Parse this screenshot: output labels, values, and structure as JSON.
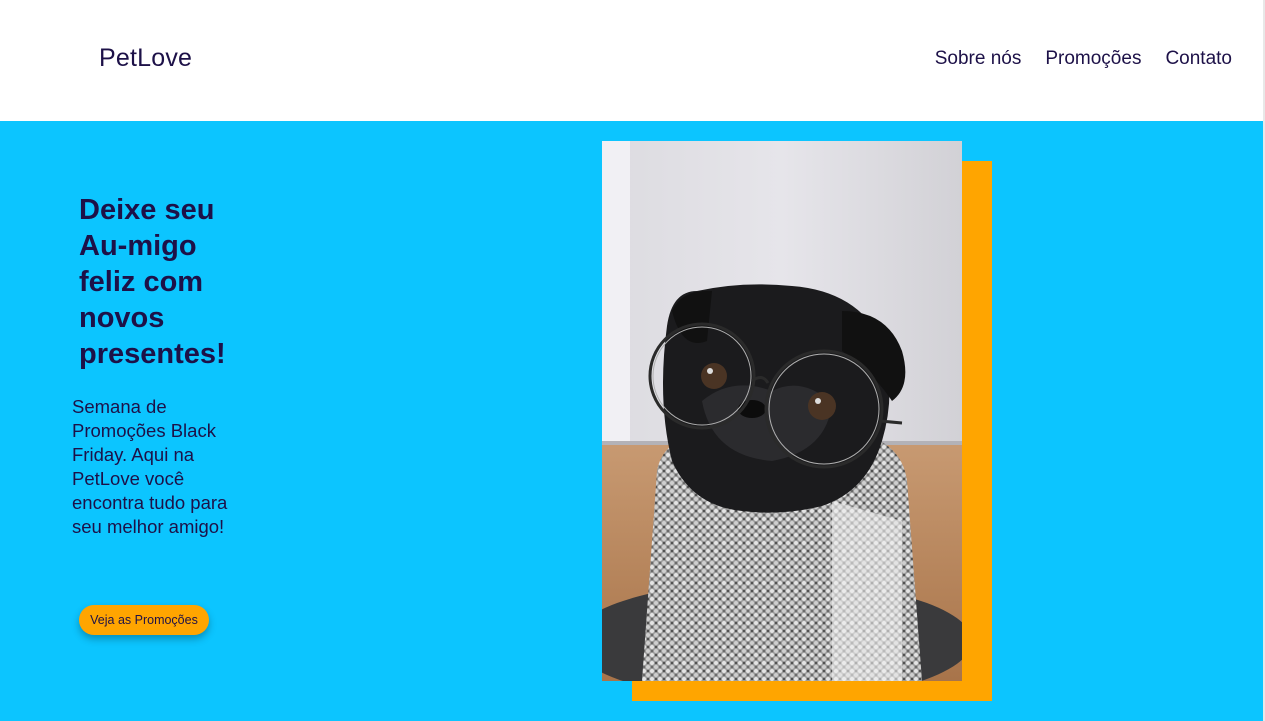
{
  "brand": {
    "name": "PetLove"
  },
  "nav": {
    "items": [
      {
        "label": "Sobre nós"
      },
      {
        "label": "Promoções"
      },
      {
        "label": "Contato"
      }
    ]
  },
  "hero": {
    "title": "Deixe seu Au-migo feliz com novos presentes!",
    "description": "Semana de Promoções Black Friday. Aqui na PetLove você encontra tudo para seu melhor amigo!",
    "cta_label": "Veja as Promoções"
  },
  "colors": {
    "primary": "#1d1148",
    "hero_background": "#0cc5ff",
    "accent": "#ffa500",
    "header_background": "#ffffff"
  },
  "image": {
    "subject": "pug-with-glasses-photo"
  }
}
